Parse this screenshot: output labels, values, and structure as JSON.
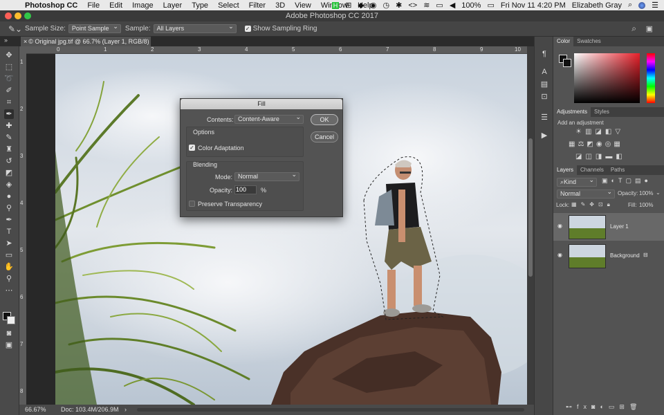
{
  "menubar": {
    "app_name": "Photoshop CC",
    "items": [
      "File",
      "Edit",
      "Image",
      "Layer",
      "Type",
      "Select",
      "Filter",
      "3D",
      "View",
      "Window",
      "Help"
    ],
    "battery": "100%",
    "datetime": "Fri Nov 11  4:20 PM",
    "user": "Elizabeth Gray"
  },
  "window": {
    "title": "Adobe Photoshop CC 2017"
  },
  "options": {
    "sample_size_label": "Sample Size:",
    "sample_size_value": "Point Sample",
    "sample_label": "Sample:",
    "sample_value": "All Layers",
    "ring_label": "Show Sampling Ring"
  },
  "document": {
    "tab_title": "© Original jpg.tif @ 66.7% (Layer 1, RGB/8) *",
    "ruler_top": [
      "0",
      "1",
      "2",
      "3",
      "4",
      "5",
      "6",
      "7",
      "8",
      "9",
      "10"
    ],
    "ruler_left": [
      "1",
      "2",
      "3",
      "4",
      "5",
      "6",
      "7",
      "8"
    ],
    "zoom": "66.67%",
    "doc_info": "Doc: 103.4M/206.9M"
  },
  "dialog": {
    "title": "Fill",
    "contents_label": "Contents:",
    "contents_value": "Content-Aware",
    "options_heading": "Options",
    "color_adaptation": "Color Adaptation",
    "blending_heading": "Blending",
    "mode_label": "Mode:",
    "mode_value": "Normal",
    "opacity_label": "Opacity:",
    "opacity_value": "100",
    "opacity_unit": "%",
    "preserve_transparency": "Preserve Transparency",
    "ok": "OK",
    "cancel": "Cancel"
  },
  "panels": {
    "color_tabs": [
      "Color",
      "Swatches"
    ],
    "adjust_tabs": [
      "Adjustments",
      "Styles"
    ],
    "add_adjustment": "Add an adjustment",
    "layer_tabs": [
      "Layers",
      "Channels",
      "Paths"
    ],
    "kind": "Kind",
    "blend_mode": "Normal",
    "opacity_label": "Opacity:",
    "opacity_value": "100%",
    "lock_label": "Lock:",
    "fill_label": "Fill:",
    "fill_value": "100%",
    "layers": [
      {
        "name": "Layer 1"
      },
      {
        "name": "Background"
      }
    ]
  },
  "colors": {
    "accent": "#3b6fb6",
    "bg": "#535353",
    "dark": "#2b2b2b"
  }
}
